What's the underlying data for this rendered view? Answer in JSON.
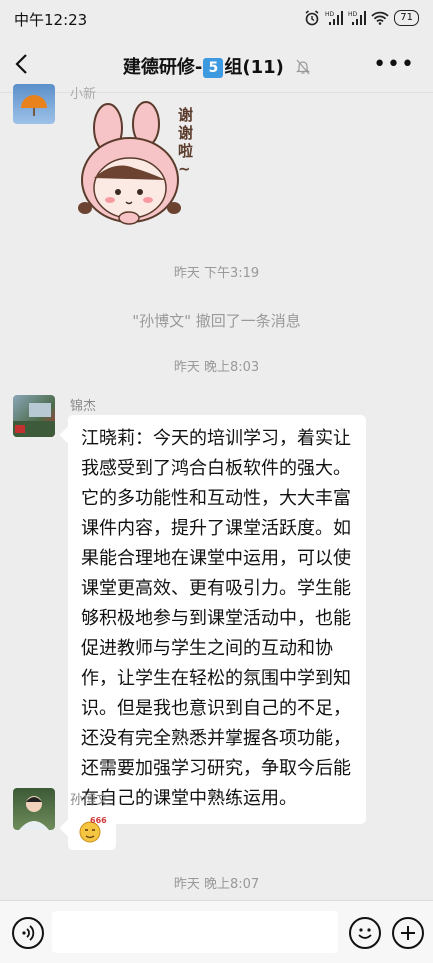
{
  "status_bar": {
    "time": "中午12:23",
    "battery": "71",
    "icons": [
      "alarm-icon",
      "signal-hd-icon",
      "signal-hd-icon",
      "wifi-icon",
      "battery-icon"
    ]
  },
  "header": {
    "title_prefix": "建德研修-",
    "title_number": "5",
    "title_suffix": "组(11)",
    "icons": [
      "back-icon",
      "mute-bell-icon",
      "more-icon"
    ]
  },
  "messages": [
    {
      "type": "sticker",
      "sender": "小新",
      "sticker_text": "谢谢啦~"
    },
    {
      "type": "timestamp",
      "text": "昨天 下午3:19"
    },
    {
      "type": "recall",
      "text": "\"孙博文\" 撤回了一条消息"
    },
    {
      "type": "timestamp",
      "text": "昨天 晚上8:03"
    },
    {
      "type": "text",
      "sender": "锦杰",
      "text": "江晓莉：今天的培训学习，着实让我感受到了鸿合白板软件的强大。它的多功能性和互动性，大大丰富课件内容，提升了课堂活跃度。如果能合理地在课堂中运用，可以使课堂更高效、更有吸引力。学生能够积极地参与到课堂活动中，也能促进教师与学生之间的互动和协作，让学生在轻松的氛围中学到知识。但是我也意识到自己的不足，还没有完全熟悉并掌握各项功能，还需要加强学习研究，争取今后能在自己的课堂中熟练运用。"
    },
    {
      "type": "emoji",
      "sender": "孙博文",
      "emoji_label": "666"
    },
    {
      "type": "timestamp",
      "text": "昨天 晚上8:07"
    }
  ],
  "input_bar": {
    "icons": [
      "voice-icon",
      "emoji-icon",
      "plus-icon"
    ]
  }
}
